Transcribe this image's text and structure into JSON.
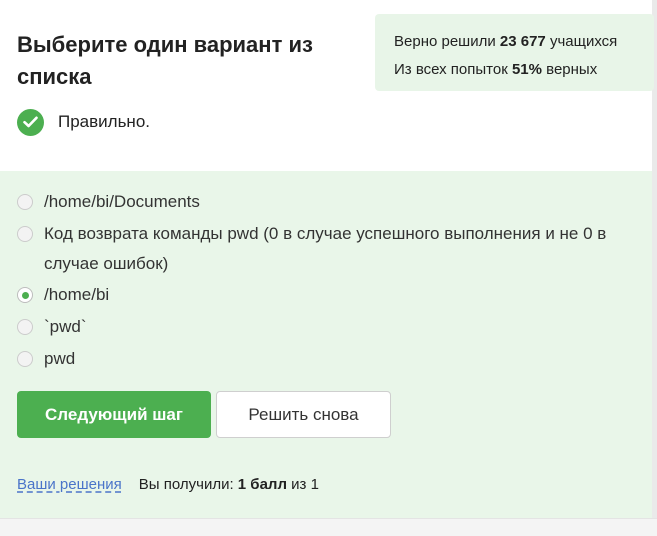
{
  "question": {
    "title": "Выберите один вариант из списка"
  },
  "stats": {
    "solved_prefix": "Верно решили ",
    "solved_count": "23 677",
    "solved_suffix": " учащихся",
    "attempts_prefix": "Из всех попыток ",
    "attempts_percent": "51%",
    "attempts_suffix": " верных"
  },
  "feedback": {
    "icon": "check-circle-icon",
    "text": "Правильно.",
    "color": "#4caf50"
  },
  "options": [
    {
      "label": "/home/bi/Documents",
      "selected": false
    },
    {
      "label": "Код возврата команды pwd (0 в случае успешного выполнения и не 0 в случае ошибок)",
      "selected": false
    },
    {
      "label": "/home/bi",
      "selected": true
    },
    {
      "label": "`pwd`",
      "selected": false
    },
    {
      "label": "pwd",
      "selected": false
    }
  ],
  "actions": {
    "next_label": "Следующий шаг",
    "retry_label": "Решить снова"
  },
  "footer": {
    "solutions_link": "Ваши решения",
    "score_prefix": "Вы получили: ",
    "score_value": "1 балл",
    "score_suffix": " из 1"
  },
  "colors": {
    "accent": "#4caf50",
    "panel_bg": "#e9f6e9",
    "stats_bg": "#e8f5e8",
    "link": "#4a74c9"
  }
}
